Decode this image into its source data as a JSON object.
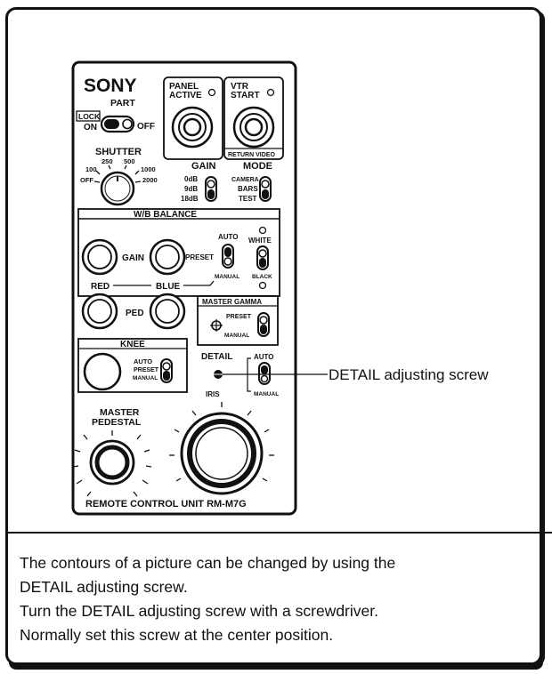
{
  "panel": {
    "brand": "SONY",
    "part_label": "PART",
    "lock_label": "LOCK",
    "on_label": "ON",
    "off_label": "OFF",
    "panel_active_line1": "PANEL",
    "panel_active_line2": "ACTIVE",
    "vtr_start_line1": "VTR",
    "vtr_start_line2": "START",
    "return_video": "RETURN VIDEO",
    "shutter_label": "SHUTTER",
    "shutter_250": "250",
    "shutter_500": "500",
    "shutter_100": "100",
    "shutter_1000": "1000",
    "shutter_off": "OFF",
    "shutter_2000": "2000",
    "gain_label": "GAIN",
    "gain_0db": "0dB",
    "gain_9db": "9dB",
    "gain_18db": "18dB",
    "mode_label": "MODE",
    "mode_camera": "CAMERA",
    "mode_bars": "BARS",
    "mode_test": "TEST",
    "wb_balance": "W/B  BALANCE",
    "wb_gain": "GAIN",
    "wb_preset": "PRESET",
    "wb_auto": "AUTO",
    "wb_white": "WHITE",
    "wb_manual": "MANUAL",
    "wb_black": "BLACK",
    "red_label": "RED",
    "blue_label": "BLUE",
    "ped_label": "PED",
    "master_gamma": "MASTER GAMMA",
    "mg_preset": "PRESET",
    "mg_manual": "MANUAL",
    "knee_label": "KNEE",
    "knee_auto": "AUTO",
    "knee_preset": "PRESET",
    "knee_manual": "MANUAL",
    "detail_label": "DETAIL",
    "detail_auto": "AUTO",
    "detail_manual": "MANUAL",
    "iris_label": "IRIS",
    "master_label": "MASTER",
    "pedestal_label": "PEDESTAL",
    "footer": "REMOTE  CONTROL  UNIT  RM-M7G"
  },
  "callout": "DETAIL adjusting screw",
  "description": [
    "The contours of a picture can be changed by using the",
    "DETAIL adjusting screw.",
    "Turn the DETAIL adjusting screw with a screwdriver.",
    "Normally set this screw at the center position."
  ]
}
